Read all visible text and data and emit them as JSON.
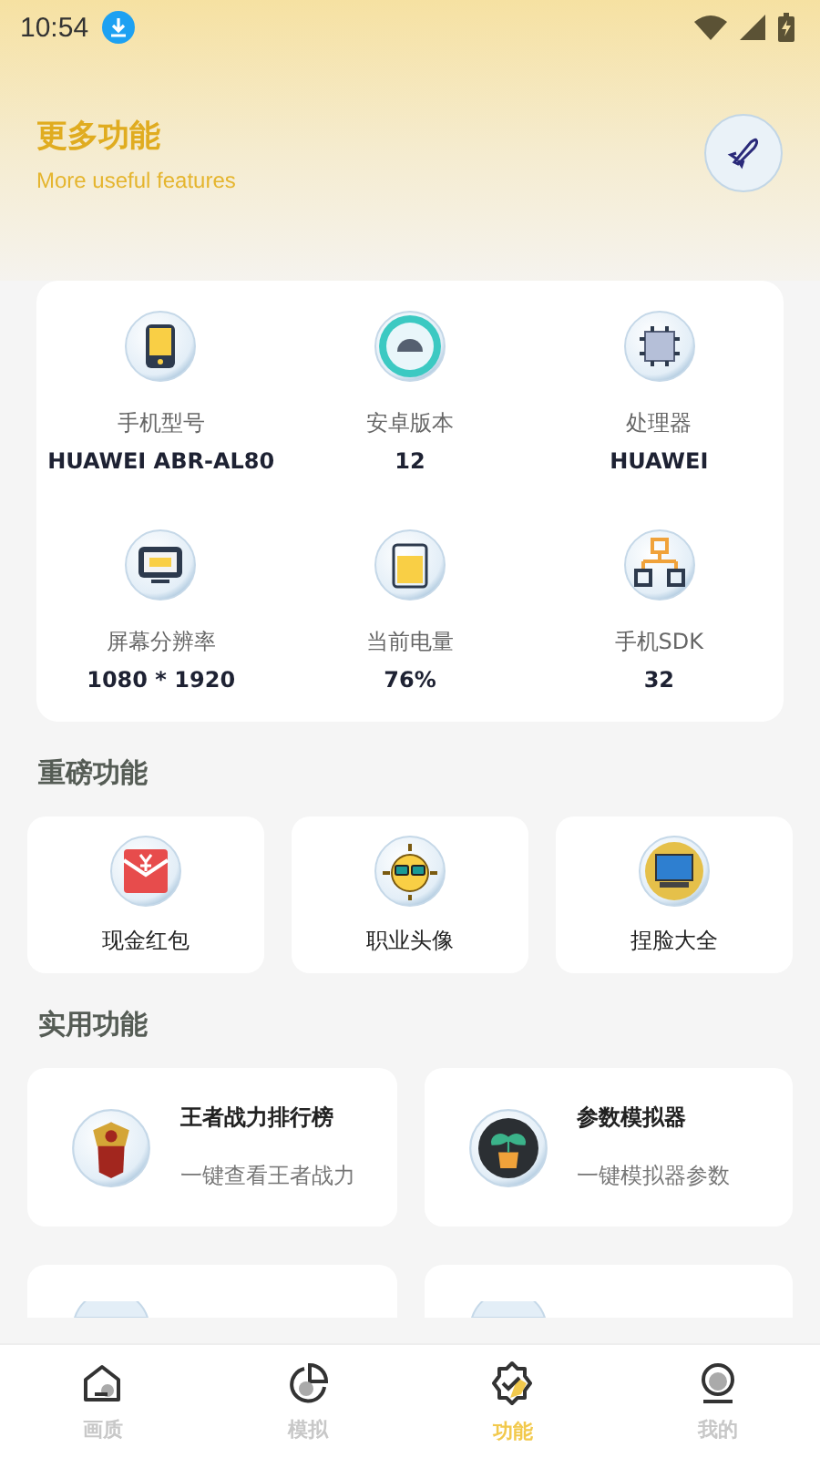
{
  "status_bar": {
    "time": "10:54"
  },
  "header": {
    "title": "更多功能",
    "subtitle": "More useful features"
  },
  "device_info": [
    {
      "kind": "phone",
      "label": "手机型号",
      "value": "HUAWEI ABR-AL80"
    },
    {
      "kind": "android",
      "label": "安卓版本",
      "value": "12"
    },
    {
      "kind": "chip",
      "label": "处理器",
      "value": "HUAWEI"
    },
    {
      "kind": "monitor",
      "label": "屏幕分辨率",
      "value": "1080 * 1920"
    },
    {
      "kind": "battery",
      "label": "当前电量",
      "value": "76%"
    },
    {
      "kind": "network",
      "label": "手机SDK",
      "value": "32"
    }
  ],
  "featured": {
    "title": "重磅功能",
    "items": [
      {
        "kind": "envelope",
        "label": "现金红包"
      },
      {
        "kind": "sun",
        "label": "职业头像"
      },
      {
        "kind": "computer",
        "label": "捏脸大全"
      }
    ]
  },
  "practical": {
    "title": "实用功能",
    "items": [
      {
        "kind": "emblem",
        "title": "王者战力排行榜",
        "subtitle": "一键查看王者战力"
      },
      {
        "kind": "plant",
        "title": "参数模拟器",
        "subtitle": "一键模拟器参数"
      },
      {
        "kind": "bubble"
      },
      {
        "kind": "bubble"
      }
    ]
  },
  "bottom_nav": [
    {
      "kind": "home",
      "label": "画质",
      "selected": false
    },
    {
      "kind": "pie",
      "label": "模拟",
      "selected": false
    },
    {
      "kind": "badge",
      "label": "功能",
      "selected": true
    },
    {
      "kind": "profile",
      "label": "我的",
      "selected": false
    }
  ]
}
